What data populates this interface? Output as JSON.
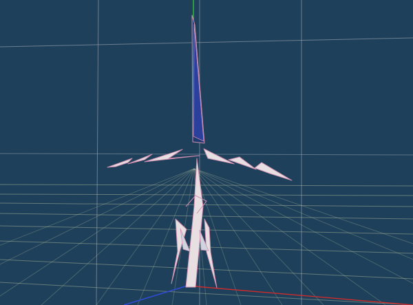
{
  "viewport": {
    "background_color": "#1f405a",
    "grid_floor_color": "#b7c5a4",
    "grid_back_color": "#a9b3bf",
    "axis_x_color": "#d12b2b",
    "axis_y_color": "#33c233",
    "axis_z_color": "#2f4bd6"
  },
  "model": {
    "fill_color": "#e7dfe2",
    "accent_fill_color": "#2b3f9d",
    "edge_color": "#cf8fb0"
  }
}
